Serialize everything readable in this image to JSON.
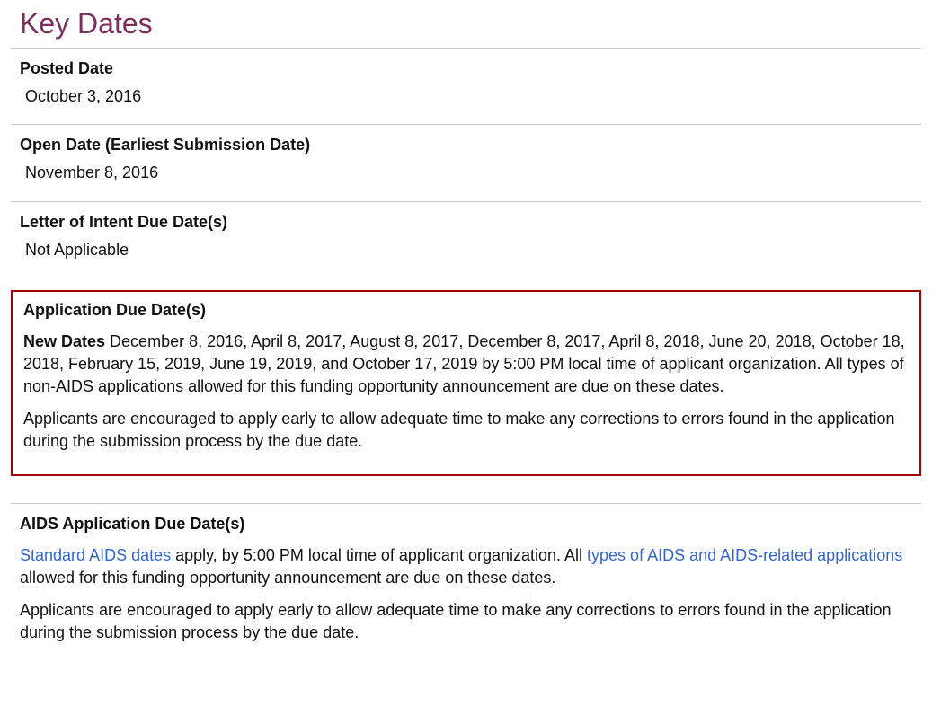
{
  "heading": "Key Dates",
  "posted": {
    "label": "Posted Date",
    "value": "October 3, 2016"
  },
  "open": {
    "label": "Open Date (Earliest Submission Date)",
    "value": "November 8, 2016"
  },
  "loi": {
    "label": "Letter of Intent Due Date(s)",
    "value": "Not Applicable"
  },
  "appDue": {
    "label": "Application Due Date(s)",
    "newLabel": "New Dates",
    "newDatesText": " December 8, 2016, April 8, 2017, August 8, 2017, December 8, 2017, April 8, 2018, June 20, 2018, October 18, 2018, February 15, 2019, June 19, 2019, and October 17, 2019 by 5:00 PM local time of applicant organization. All types of non-AIDS applications allowed for this funding opportunity announcement are due on these dates.",
    "para2": "Applicants are encouraged to apply early to allow adequate time to make any corrections to errors found in the application during the submission process by the due date."
  },
  "aidsDue": {
    "label": "AIDS Application Due Date(s)",
    "link1": "Standard AIDS dates",
    "mid1": " apply, by 5:00 PM local time of applicant organization. All ",
    "link2": "types of AIDS and AIDS-related applications",
    "mid2": " allowed for this funding opportunity announcement are due on these dates.",
    "para2": "Applicants are encouraged to apply early to allow adequate time to make any corrections to errors found in the application during the submission process by the due date."
  }
}
